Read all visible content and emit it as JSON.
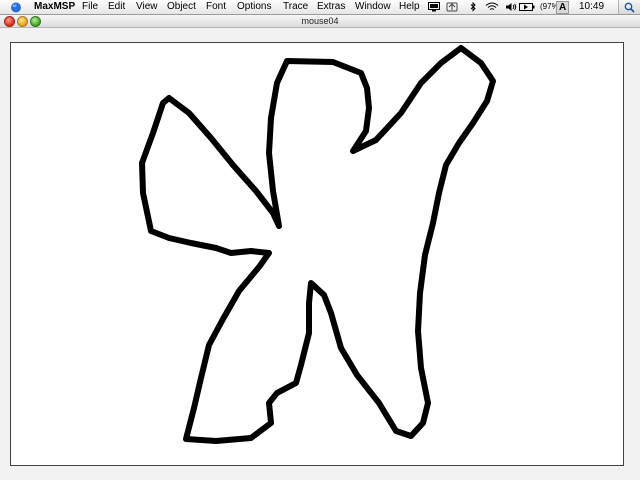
{
  "menubar": {
    "app_name": "MaxMSP",
    "items": [
      "File",
      "Edit",
      "View",
      "Object",
      "Font",
      "Options",
      "Trace",
      "Extras",
      "Window",
      "Help"
    ],
    "battery": "(97%)",
    "clock": "10:49",
    "input_menu": "A"
  },
  "window": {
    "title": "mouse04"
  },
  "colors": {
    "stroke": "#000000",
    "canvas": "#ffffff"
  }
}
